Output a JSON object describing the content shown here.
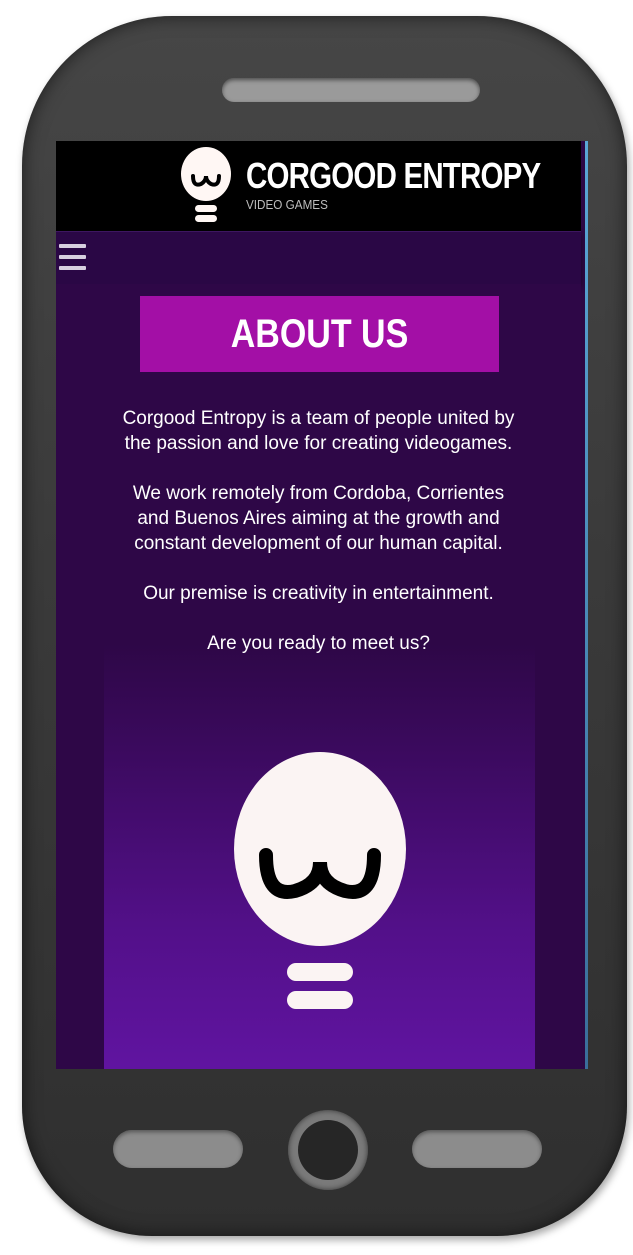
{
  "header": {
    "brand_name": "CORGOOD ENTROPY",
    "tagline": "VIDEO GAMES"
  },
  "nav": {
    "menu_icon": "hamburger-menu-icon"
  },
  "about": {
    "title": "ABOUT US",
    "paragraphs": [
      "Corgood Entropy is a team of people united by the passion and love for creating videogames.",
      "We work remotely from Cordoba, Corrientes and Buenos Aires aiming at the growth and constant development of our human capital.",
      "Our premise is creativity in entertainment.",
      "Are you ready to meet us?"
    ]
  },
  "colors": {
    "page_background": "#2e0747",
    "header_background": "#000000",
    "title_box": "#a30fa6",
    "panel_bottom": "#6a17b1",
    "text": "#ffffff"
  }
}
